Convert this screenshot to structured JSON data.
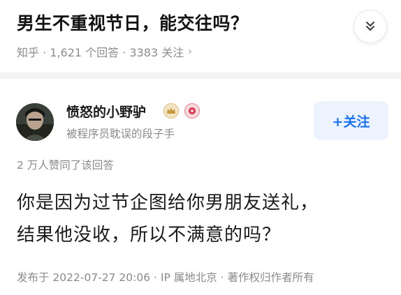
{
  "question": {
    "title": "男生不重视节日，能交往吗？",
    "meta": "知乎 · 1,621 个回答 · 3383 关注",
    "meta_chevron": "›",
    "collapse_icon": "double-chevron-down-icon"
  },
  "answer": {
    "author": {
      "name": "愤怒的小野驴",
      "bio": "被程序员耽误的段子手",
      "badges": [
        "crown-badge-icon",
        "red-badge-icon"
      ]
    },
    "follow_button_label": "+关注",
    "upvote_info": "2 万人赞同了该回答",
    "body_lines": [
      "你是因为过节企图给你男朋友送礼，",
      "结果他没收，所以不满意的吗？"
    ],
    "footer": "发布于 2022-07-27 20:06 · IP 属地北京 · 著作权归作者所有"
  },
  "colors": {
    "accent": "#1772f6",
    "follow_bg": "#eef4ff",
    "meta_text": "#8a8a8a",
    "divider": "#f3f3f3"
  }
}
